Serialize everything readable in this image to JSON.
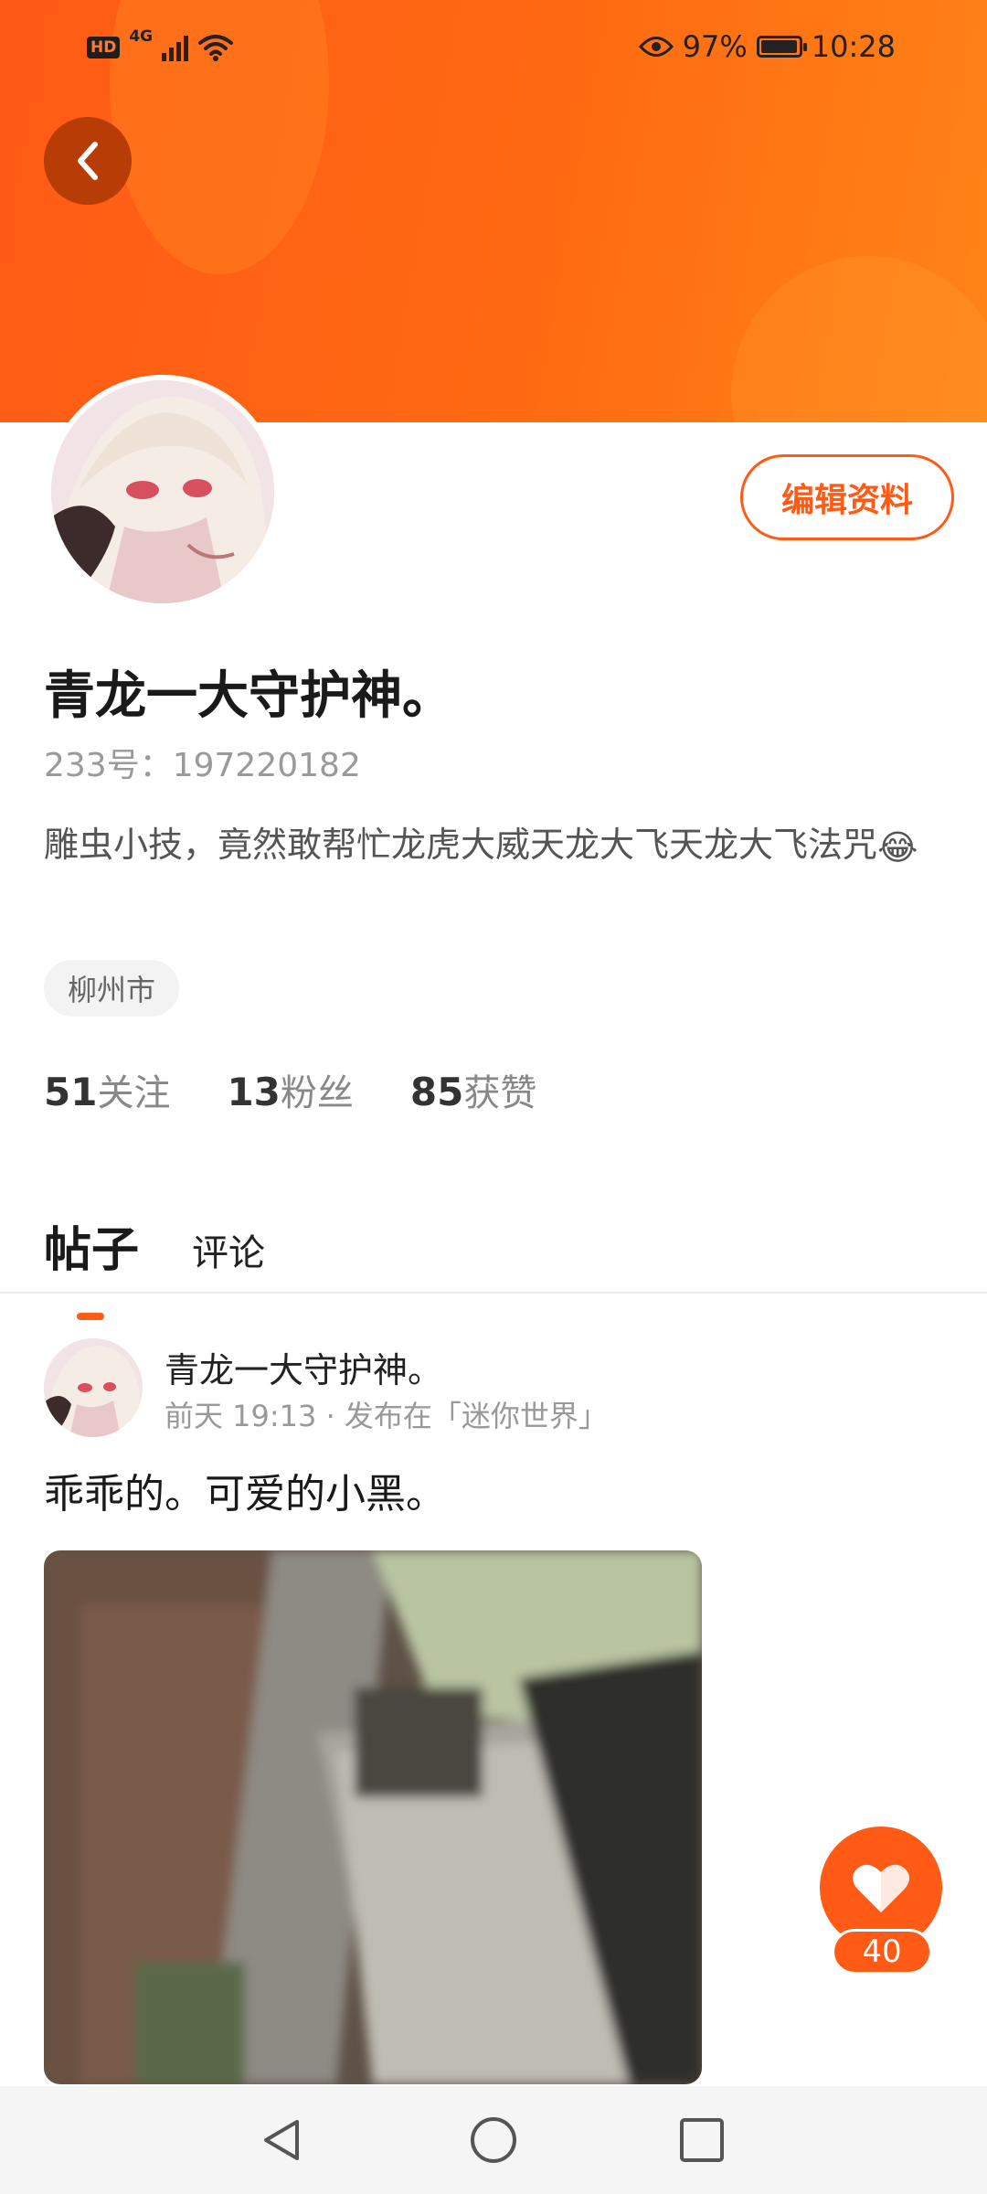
{
  "status_bar": {
    "hd_label": "HD",
    "network_label": "4G",
    "battery_percent": "97%",
    "battery_level": 0.97,
    "time": "10:28"
  },
  "profile": {
    "edit_button": "编辑资料",
    "username": "青龙一大守护神。",
    "user_id": "233号：197220182",
    "bio": "雕虫小技，竟然敢帮忙龙虎大威天龙大飞天龙大飞法咒",
    "bio_emoji": "😂",
    "location": "柳州市",
    "stats": [
      {
        "num": "51",
        "label": "关注"
      },
      {
        "num": "13",
        "label": "粉丝"
      },
      {
        "num": "85",
        "label": "获赞"
      }
    ]
  },
  "tabs": [
    {
      "label": "帖子",
      "active": true
    },
    {
      "label": "评论",
      "active": false
    }
  ],
  "post": {
    "author": "青龙一大守护神。",
    "meta": "前天 19:13 · 发布在「迷你世界」",
    "text": "乖乖的。可爱的小黑。"
  },
  "like": {
    "count": "40"
  },
  "colors": {
    "accent": "#ff5a16",
    "banner_end": "#ff8417",
    "back_button": "#b73c06"
  },
  "icons": [
    "back-arrow-icon",
    "eye-icon",
    "wifi-icon",
    "signal-icon",
    "battery-icon",
    "heart-icon",
    "nav-back-icon",
    "nav-home-icon",
    "nav-recents-icon"
  ]
}
